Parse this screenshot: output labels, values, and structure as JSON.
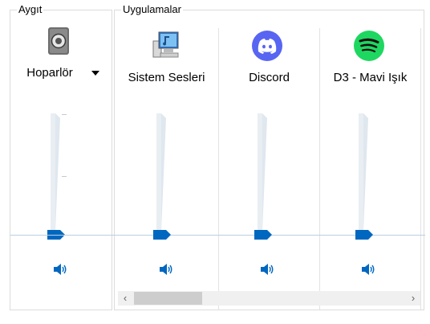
{
  "device": {
    "title": "Aygıt",
    "name": "Hoparlör",
    "volume": 0.15
  },
  "apps": {
    "title": "Uygulamalar",
    "items": [
      {
        "label": "Sistem Sesleri",
        "icon": "system-sounds-icon",
        "volume": 0.15
      },
      {
        "label": "Discord",
        "icon": "discord-icon",
        "volume": 0.15
      },
      {
        "label": "D3 - Mavi Işık",
        "icon": "spotify-icon",
        "volume": 0.15
      }
    ]
  },
  "colors": {
    "accent": "#0067c0",
    "discord": "#5865f2",
    "spotify": "#1ed760"
  }
}
